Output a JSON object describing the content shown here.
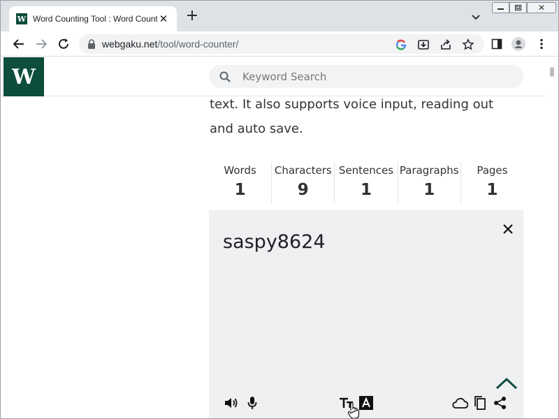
{
  "browser": {
    "tab_title": "Word Counting Tool : Word Counter",
    "favicon_letter": "W",
    "url_domain": "webgaku.net",
    "url_path": "/tool/word-counter/"
  },
  "site": {
    "logo_letter": "W",
    "search_placeholder": "Keyword Search",
    "intro_text": "text. It also supports voice input, reading out and auto save."
  },
  "stats": [
    {
      "label": "Words",
      "value": "1"
    },
    {
      "label": "Characters",
      "value": "9"
    },
    {
      "label": "Sentences",
      "value": "1"
    },
    {
      "label": "Paragraphs",
      "value": "1"
    },
    {
      "label": "Pages",
      "value": "1"
    }
  ],
  "editor": {
    "text": "saspy8624"
  },
  "colors": {
    "brand": "#0d4d3c",
    "tab_strip": "#dee1e6",
    "editor_bg": "#eef0f1"
  }
}
